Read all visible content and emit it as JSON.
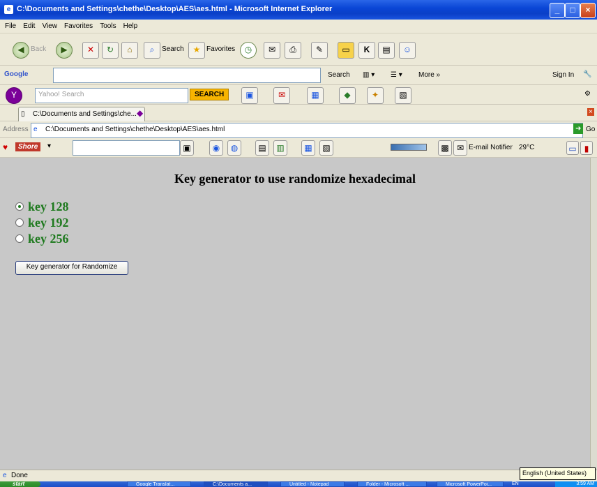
{
  "window": {
    "title": "C:\\Documents and Settings\\chethe\\Desktop\\AES\\aes.html - Microsoft Internet Explorer"
  },
  "menu": [
    "File",
    "Edit",
    "View",
    "Favorites",
    "Tools",
    "Help"
  ],
  "nav": {
    "back": "Back",
    "search": "Search",
    "favorites": "Favorites"
  },
  "google_bar": {
    "logo": "Google",
    "search": "Search",
    "more": "More »",
    "signin": "Sign In"
  },
  "yahoo_bar": {
    "placeholder": "Yahoo! Search",
    "search_button": "SEARCH"
  },
  "tab": {
    "label": "C:\\Documents and Settings\\che..."
  },
  "address": {
    "label": "Address",
    "value": "C:\\Documents and Settings\\chethe\\Desktop\\AES\\aes.html",
    "go": "Go"
  },
  "ext_bar": {
    "brand": "Shore",
    "email": "E-mail Notifier",
    "temp": "29°C"
  },
  "page": {
    "heading": "Key generator to use randomize hexadecimal",
    "options": [
      {
        "label": "key 128",
        "checked": true
      },
      {
        "label": "key 192",
        "checked": false
      },
      {
        "label": "key 256",
        "checked": false
      }
    ],
    "button": "Key generator for Randomize"
  },
  "status": {
    "text": "Done",
    "tooltip": "English (United States)"
  },
  "taskbar": {
    "start": "start",
    "tasks": [
      "Google Translat...",
      "C:\\Documents a...",
      "Untitled - Notepad",
      "Folder - Microsoft ...",
      "Microsoft PowerPoi..."
    ],
    "lang": "EN",
    "time": "3:59 AM"
  }
}
